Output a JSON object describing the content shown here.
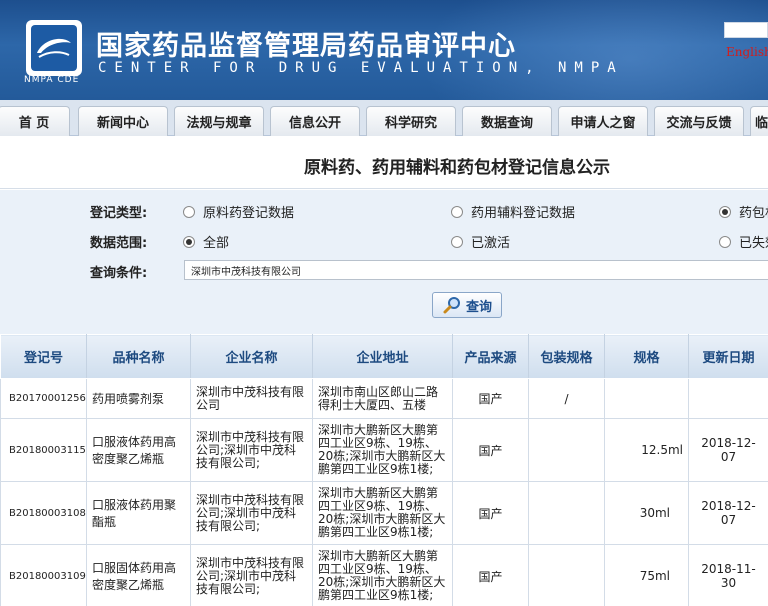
{
  "header": {
    "title_cn": "国家药品监督管理局药品审评中心",
    "title_en": "CENTER FOR DRUG EVALUATION, NMPA",
    "logo_caption": "NMPA CDE",
    "english_link": "English"
  },
  "nav": {
    "items": [
      {
        "label": "首 页"
      },
      {
        "label": "新闻中心"
      },
      {
        "label": "法规与规章"
      },
      {
        "label": "信息公开"
      },
      {
        "label": "科学研究"
      },
      {
        "label": "数据查询"
      },
      {
        "label": "申请人之窗"
      },
      {
        "label": "交流与反馈"
      },
      {
        "label": "临"
      }
    ]
  },
  "page_title": "原料药、药用辅料和药包材登记信息公示",
  "form": {
    "type_label": "登记类型:",
    "type_options": [
      {
        "label": "原料药登记数据",
        "selected": false
      },
      {
        "label": "药用辅料登记数据",
        "selected": false
      },
      {
        "label": "药包材",
        "selected": true
      }
    ],
    "range_label": "数据范围:",
    "range_options": [
      {
        "label": "全部",
        "selected": true
      },
      {
        "label": "已激活",
        "selected": false
      },
      {
        "label": "已失效",
        "selected": false
      }
    ],
    "query_label": "查询条件:",
    "query_value": "深圳市中茂科技有限公司",
    "query_button": "查询"
  },
  "table": {
    "headers": [
      "登记号",
      "品种名称",
      "企业名称",
      "企业地址",
      "产品来源",
      "包装规格",
      "规格",
      "更新日期"
    ],
    "rows": [
      {
        "code": "B20170001256",
        "name": "药用喷雾剂泵",
        "enterprise": "深圳市中茂科技有限公司",
        "address": "深圳市南山区郎山二路得利士大厦四、五楼",
        "source": "国产",
        "package": "/",
        "spec": "",
        "date": ""
      },
      {
        "code": "B20180003115",
        "name": "口服液体药用高密度聚乙烯瓶",
        "enterprise": "深圳市中茂科技有限公司;深圳市中茂科技有限公司;",
        "address": "深圳市大鹏新区大鹏第四工业区9栋、19栋、20栋;深圳市大鹏新区大鹏第四工业区9栋1楼;",
        "source": "国产",
        "package": "",
        "spec": "12.5ml",
        "date": "2018-12-07"
      },
      {
        "code": "B20180003108",
        "name": "口服液体药用聚酯瓶",
        "enterprise": "深圳市中茂科技有限公司;深圳市中茂科技有限公司;",
        "address": "深圳市大鹏新区大鹏第四工业区9栋、19栋、20栋;深圳市大鹏新区大鹏第四工业区9栋1楼;",
        "source": "国产",
        "package": "",
        "spec": "30ml",
        "date": "2018-12-07"
      },
      {
        "code": "B20180003109",
        "name": "口服固体药用高密度聚乙烯瓶",
        "enterprise": "深圳市中茂科技有限公司;深圳市中茂科技有限公司;",
        "address": "深圳市大鹏新区大鹏第四工业区9栋、19栋、20栋;深圳市大鹏新区大鹏第四工业区9栋1楼;",
        "source": "国产",
        "package": "",
        "spec": "75ml",
        "date": "2018-11-30"
      }
    ]
  }
}
